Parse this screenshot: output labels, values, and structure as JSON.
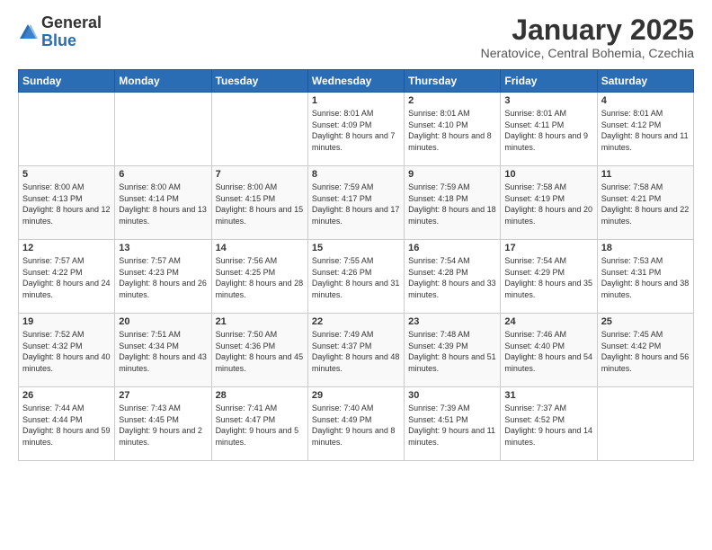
{
  "header": {
    "logo_general": "General",
    "logo_blue": "Blue",
    "month_title": "January 2025",
    "location": "Neratovice, Central Bohemia, Czechia"
  },
  "weekdays": [
    "Sunday",
    "Monday",
    "Tuesday",
    "Wednesday",
    "Thursday",
    "Friday",
    "Saturday"
  ],
  "weeks": [
    [
      {
        "day": "",
        "sunrise": "",
        "sunset": "",
        "daylight": ""
      },
      {
        "day": "",
        "sunrise": "",
        "sunset": "",
        "daylight": ""
      },
      {
        "day": "",
        "sunrise": "",
        "sunset": "",
        "daylight": ""
      },
      {
        "day": "1",
        "sunrise": "Sunrise: 8:01 AM",
        "sunset": "Sunset: 4:09 PM",
        "daylight": "Daylight: 8 hours and 7 minutes."
      },
      {
        "day": "2",
        "sunrise": "Sunrise: 8:01 AM",
        "sunset": "Sunset: 4:10 PM",
        "daylight": "Daylight: 8 hours and 8 minutes."
      },
      {
        "day": "3",
        "sunrise": "Sunrise: 8:01 AM",
        "sunset": "Sunset: 4:11 PM",
        "daylight": "Daylight: 8 hours and 9 minutes."
      },
      {
        "day": "4",
        "sunrise": "Sunrise: 8:01 AM",
        "sunset": "Sunset: 4:12 PM",
        "daylight": "Daylight: 8 hours and 11 minutes."
      }
    ],
    [
      {
        "day": "5",
        "sunrise": "Sunrise: 8:00 AM",
        "sunset": "Sunset: 4:13 PM",
        "daylight": "Daylight: 8 hours and 12 minutes."
      },
      {
        "day": "6",
        "sunrise": "Sunrise: 8:00 AM",
        "sunset": "Sunset: 4:14 PM",
        "daylight": "Daylight: 8 hours and 13 minutes."
      },
      {
        "day": "7",
        "sunrise": "Sunrise: 8:00 AM",
        "sunset": "Sunset: 4:15 PM",
        "daylight": "Daylight: 8 hours and 15 minutes."
      },
      {
        "day": "8",
        "sunrise": "Sunrise: 7:59 AM",
        "sunset": "Sunset: 4:17 PM",
        "daylight": "Daylight: 8 hours and 17 minutes."
      },
      {
        "day": "9",
        "sunrise": "Sunrise: 7:59 AM",
        "sunset": "Sunset: 4:18 PM",
        "daylight": "Daylight: 8 hours and 18 minutes."
      },
      {
        "day": "10",
        "sunrise": "Sunrise: 7:58 AM",
        "sunset": "Sunset: 4:19 PM",
        "daylight": "Daylight: 8 hours and 20 minutes."
      },
      {
        "day": "11",
        "sunrise": "Sunrise: 7:58 AM",
        "sunset": "Sunset: 4:21 PM",
        "daylight": "Daylight: 8 hours and 22 minutes."
      }
    ],
    [
      {
        "day": "12",
        "sunrise": "Sunrise: 7:57 AM",
        "sunset": "Sunset: 4:22 PM",
        "daylight": "Daylight: 8 hours and 24 minutes."
      },
      {
        "day": "13",
        "sunrise": "Sunrise: 7:57 AM",
        "sunset": "Sunset: 4:23 PM",
        "daylight": "Daylight: 8 hours and 26 minutes."
      },
      {
        "day": "14",
        "sunrise": "Sunrise: 7:56 AM",
        "sunset": "Sunset: 4:25 PM",
        "daylight": "Daylight: 8 hours and 28 minutes."
      },
      {
        "day": "15",
        "sunrise": "Sunrise: 7:55 AM",
        "sunset": "Sunset: 4:26 PM",
        "daylight": "Daylight: 8 hours and 31 minutes."
      },
      {
        "day": "16",
        "sunrise": "Sunrise: 7:54 AM",
        "sunset": "Sunset: 4:28 PM",
        "daylight": "Daylight: 8 hours and 33 minutes."
      },
      {
        "day": "17",
        "sunrise": "Sunrise: 7:54 AM",
        "sunset": "Sunset: 4:29 PM",
        "daylight": "Daylight: 8 hours and 35 minutes."
      },
      {
        "day": "18",
        "sunrise": "Sunrise: 7:53 AM",
        "sunset": "Sunset: 4:31 PM",
        "daylight": "Daylight: 8 hours and 38 minutes."
      }
    ],
    [
      {
        "day": "19",
        "sunrise": "Sunrise: 7:52 AM",
        "sunset": "Sunset: 4:32 PM",
        "daylight": "Daylight: 8 hours and 40 minutes."
      },
      {
        "day": "20",
        "sunrise": "Sunrise: 7:51 AM",
        "sunset": "Sunset: 4:34 PM",
        "daylight": "Daylight: 8 hours and 43 minutes."
      },
      {
        "day": "21",
        "sunrise": "Sunrise: 7:50 AM",
        "sunset": "Sunset: 4:36 PM",
        "daylight": "Daylight: 8 hours and 45 minutes."
      },
      {
        "day": "22",
        "sunrise": "Sunrise: 7:49 AM",
        "sunset": "Sunset: 4:37 PM",
        "daylight": "Daylight: 8 hours and 48 minutes."
      },
      {
        "day": "23",
        "sunrise": "Sunrise: 7:48 AM",
        "sunset": "Sunset: 4:39 PM",
        "daylight": "Daylight: 8 hours and 51 minutes."
      },
      {
        "day": "24",
        "sunrise": "Sunrise: 7:46 AM",
        "sunset": "Sunset: 4:40 PM",
        "daylight": "Daylight: 8 hours and 54 minutes."
      },
      {
        "day": "25",
        "sunrise": "Sunrise: 7:45 AM",
        "sunset": "Sunset: 4:42 PM",
        "daylight": "Daylight: 8 hours and 56 minutes."
      }
    ],
    [
      {
        "day": "26",
        "sunrise": "Sunrise: 7:44 AM",
        "sunset": "Sunset: 4:44 PM",
        "daylight": "Daylight: 8 hours and 59 minutes."
      },
      {
        "day": "27",
        "sunrise": "Sunrise: 7:43 AM",
        "sunset": "Sunset: 4:45 PM",
        "daylight": "Daylight: 9 hours and 2 minutes."
      },
      {
        "day": "28",
        "sunrise": "Sunrise: 7:41 AM",
        "sunset": "Sunset: 4:47 PM",
        "daylight": "Daylight: 9 hours and 5 minutes."
      },
      {
        "day": "29",
        "sunrise": "Sunrise: 7:40 AM",
        "sunset": "Sunset: 4:49 PM",
        "daylight": "Daylight: 9 hours and 8 minutes."
      },
      {
        "day": "30",
        "sunrise": "Sunrise: 7:39 AM",
        "sunset": "Sunset: 4:51 PM",
        "daylight": "Daylight: 9 hours and 11 minutes."
      },
      {
        "day": "31",
        "sunrise": "Sunrise: 7:37 AM",
        "sunset": "Sunset: 4:52 PM",
        "daylight": "Daylight: 9 hours and 14 minutes."
      },
      {
        "day": "",
        "sunrise": "",
        "sunset": "",
        "daylight": ""
      }
    ]
  ]
}
